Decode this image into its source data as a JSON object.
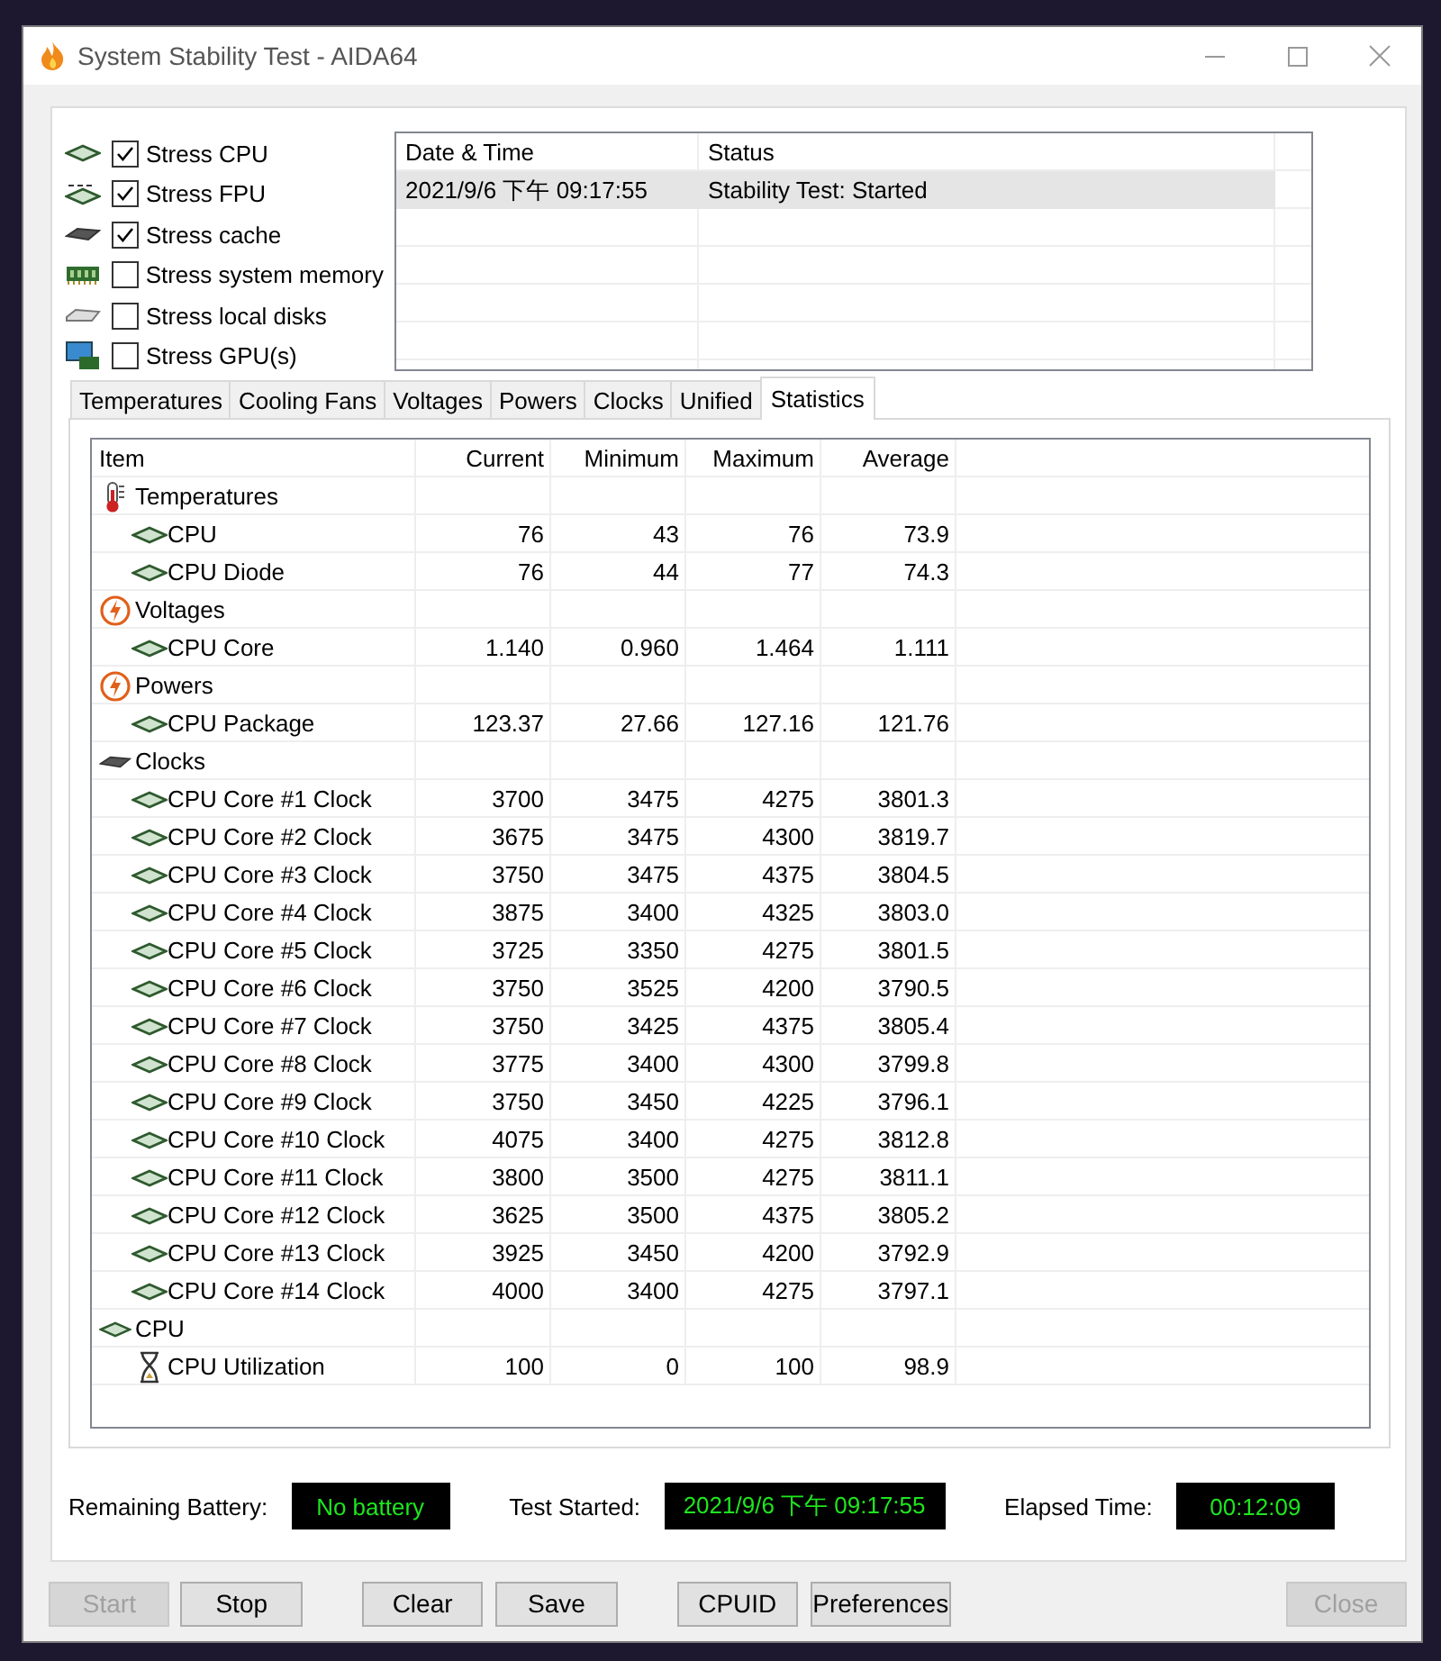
{
  "window": {
    "title": "System Stability Test - AIDA64"
  },
  "stress_options": [
    {
      "label": "Stress CPU",
      "checked": true
    },
    {
      "label": "Stress FPU",
      "checked": true
    },
    {
      "label": "Stress cache",
      "checked": true
    },
    {
      "label": "Stress system memory",
      "checked": false
    },
    {
      "label": "Stress local disks",
      "checked": false
    },
    {
      "label": "Stress GPU(s)",
      "checked": false
    }
  ],
  "log": {
    "columns": [
      "Date & Time",
      "Status"
    ],
    "rows": [
      {
        "cells": [
          "2021/9/6 下午 09:17:55",
          "Stability Test: Started"
        ],
        "selected": true
      }
    ]
  },
  "tabs": [
    {
      "label": "Temperatures",
      "selected": false
    },
    {
      "label": "Cooling Fans",
      "selected": false
    },
    {
      "label": "Voltages",
      "selected": false
    },
    {
      "label": "Powers",
      "selected": false
    },
    {
      "label": "Clocks",
      "selected": false
    },
    {
      "label": "Unified",
      "selected": false
    },
    {
      "label": "Statistics",
      "selected": true
    }
  ],
  "statistics": {
    "columns": [
      "Item",
      "Current",
      "Minimum",
      "Maximum",
      "Average"
    ],
    "groups": [
      {
        "label": "Temperatures",
        "kind": "temperature",
        "children": [
          {
            "kind": "chip",
            "cells": [
              "CPU",
              "76",
              "43",
              "76",
              "73.9"
            ]
          },
          {
            "kind": "chip",
            "cells": [
              "CPU Diode",
              "76",
              "44",
              "77",
              "74.3"
            ]
          }
        ]
      },
      {
        "label": "Voltages",
        "kind": "bolt",
        "children": [
          {
            "kind": "chip",
            "cells": [
              "CPU Core",
              "1.140",
              "0.960",
              "1.464",
              "1.111"
            ]
          }
        ]
      },
      {
        "label": "Powers",
        "kind": "bolt",
        "children": [
          {
            "kind": "chip",
            "cells": [
              "CPU Package",
              "123.37",
              "27.66",
              "127.16",
              "121.76"
            ]
          }
        ]
      },
      {
        "label": "Clocks",
        "kind": "clock",
        "children": [
          {
            "kind": "chip",
            "cells": [
              "CPU Core #1 Clock",
              "3700",
              "3475",
              "4275",
              "3801.3"
            ]
          },
          {
            "kind": "chip",
            "cells": [
              "CPU Core #2 Clock",
              "3675",
              "3475",
              "4300",
              "3819.7"
            ]
          },
          {
            "kind": "chip",
            "cells": [
              "CPU Core #3 Clock",
              "3750",
              "3475",
              "4375",
              "3804.5"
            ]
          },
          {
            "kind": "chip",
            "cells": [
              "CPU Core #4 Clock",
              "3875",
              "3400",
              "4325",
              "3803.0"
            ]
          },
          {
            "kind": "chip",
            "cells": [
              "CPU Core #5 Clock",
              "3725",
              "3350",
              "4275",
              "3801.5"
            ]
          },
          {
            "kind": "chip",
            "cells": [
              "CPU Core #6 Clock",
              "3750",
              "3525",
              "4200",
              "3790.5"
            ]
          },
          {
            "kind": "chip",
            "cells": [
              "CPU Core #7 Clock",
              "3750",
              "3425",
              "4375",
              "3805.4"
            ]
          },
          {
            "kind": "chip",
            "cells": [
              "CPU Core #8 Clock",
              "3775",
              "3400",
              "4300",
              "3799.8"
            ]
          },
          {
            "kind": "chip",
            "cells": [
              "CPU Core #9 Clock",
              "3750",
              "3450",
              "4225",
              "3796.1"
            ]
          },
          {
            "kind": "chip",
            "cells": [
              "CPU Core #10 Clock",
              "4075",
              "3400",
              "4275",
              "3812.8"
            ]
          },
          {
            "kind": "chip",
            "cells": [
              "CPU Core #11 Clock",
              "3800",
              "3500",
              "4275",
              "3811.1"
            ]
          },
          {
            "kind": "chip",
            "cells": [
              "CPU Core #12 Clock",
              "3625",
              "3500",
              "4375",
              "3805.2"
            ]
          },
          {
            "kind": "chip",
            "cells": [
              "CPU Core #13 Clock",
              "3925",
              "3450",
              "4200",
              "3792.9"
            ]
          },
          {
            "kind": "chip",
            "cells": [
              "CPU Core #14 Clock",
              "4000",
              "3400",
              "4275",
              "3797.1"
            ]
          }
        ]
      },
      {
        "label": "CPU",
        "kind": "chip",
        "children": [
          {
            "kind": "hourglass",
            "cells": [
              "CPU Utilization",
              "100",
              "0",
              "100",
              "98.9"
            ]
          }
        ]
      }
    ]
  },
  "status": [
    {
      "label": "Remaining Battery:",
      "value": "No battery"
    },
    {
      "label": "Test Started:",
      "value": "2021/9/6 下午 09:17:55"
    },
    {
      "label": "Elapsed Time:",
      "value": "00:12:09"
    }
  ],
  "buttons": [
    {
      "label": "Start",
      "disabled": true
    },
    {
      "label": "Stop",
      "disabled": false
    },
    {
      "label": "Clear",
      "disabled": false
    },
    {
      "label": "Save",
      "disabled": false
    },
    {
      "label": "CPUID",
      "disabled": false
    },
    {
      "label": "Preferences",
      "disabled": false
    },
    {
      "label": "Close",
      "disabled": true
    }
  ]
}
